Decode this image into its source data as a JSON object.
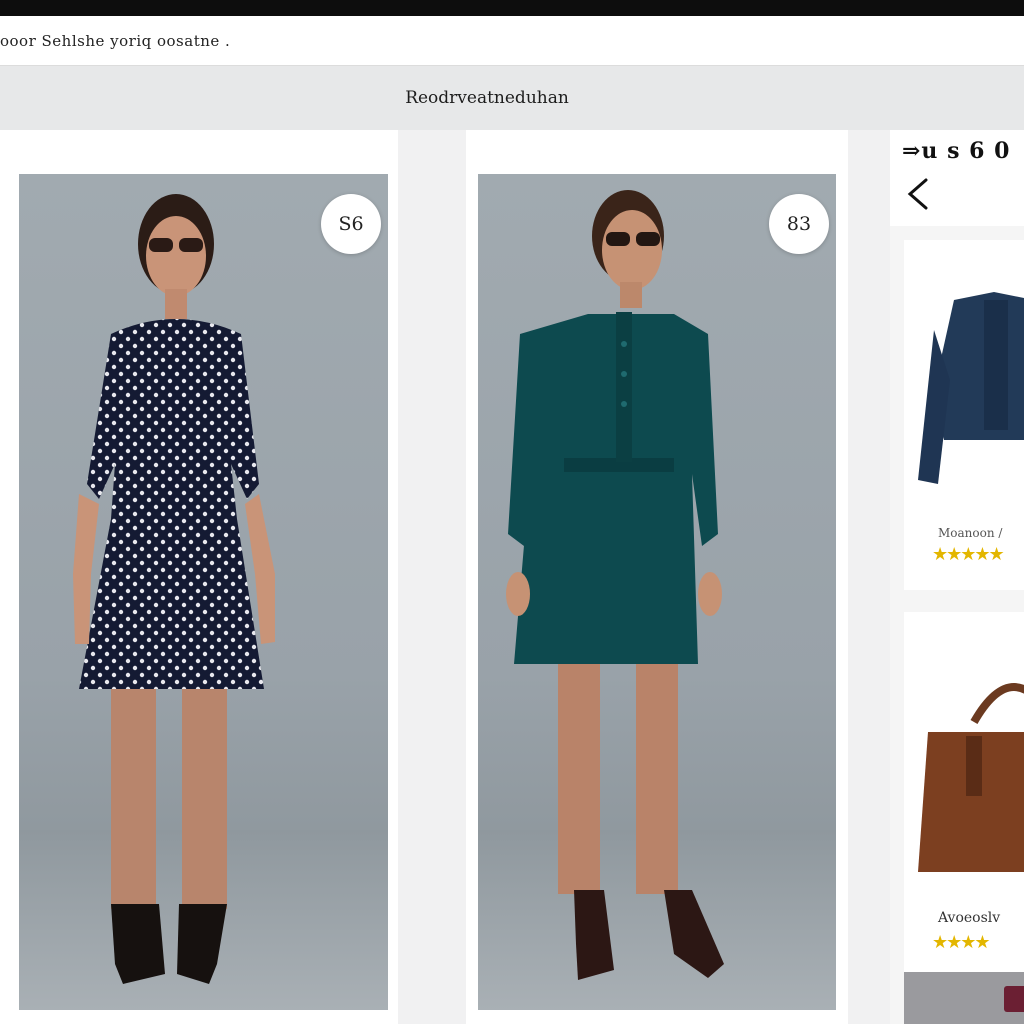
{
  "browser": {
    "url_text": "ooor Sehlshe  yoriq oosatne ."
  },
  "header": {
    "title": "Reodrveatneduhan"
  },
  "products_main": [
    {
      "price": "S6",
      "description_icon": "polka-dot-dress-photo"
    },
    {
      "price": "83",
      "description_icon": "teal-dress-photo"
    }
  ],
  "sidebar": {
    "count_text": "⇒u s  6 0",
    "back_icon": "chevron-left-icon",
    "items": [
      {
        "name": "Moanoon /",
        "rating": "★★★★★",
        "image": "denim-jacket"
      },
      {
        "name": "Avoeoslv",
        "rating": "★★★★",
        "image": "brown-handbag"
      }
    ]
  },
  "colors": {
    "rating_star": "#e3b600",
    "accent_chip": "#6b1f33",
    "photo_backdrop": "#9aa3a9"
  }
}
